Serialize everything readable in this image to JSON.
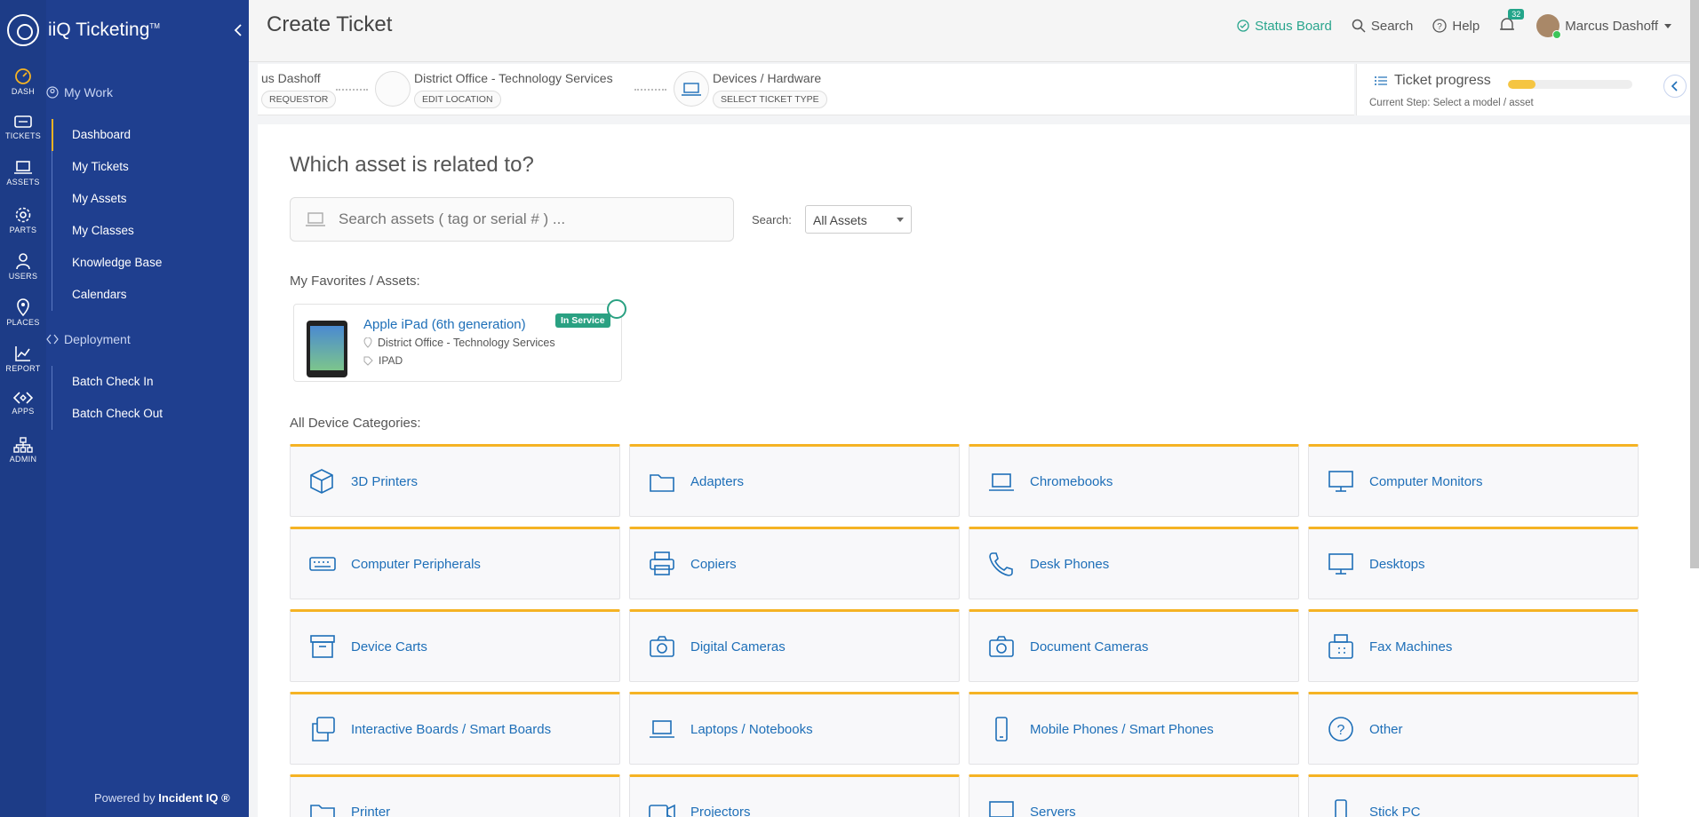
{
  "app": {
    "brand": "iiQ Ticketing",
    "trademark": "TM",
    "powered_prefix": "Powered by",
    "powered_brand": "Incident IQ ®"
  },
  "rail": [
    {
      "label": "DASH",
      "icon": "dashboard-icon"
    },
    {
      "label": "TICKETS",
      "icon": "tickets-icon"
    },
    {
      "label": "ASSETS",
      "icon": "laptop-icon"
    },
    {
      "label": "PARTS",
      "icon": "gear-icon"
    },
    {
      "label": "USERS",
      "icon": "user-icon"
    },
    {
      "label": "PLACES",
      "icon": "map-pin-icon"
    },
    {
      "label": "REPORT",
      "icon": "chart-icon"
    },
    {
      "label": "APPS",
      "icon": "apps-icon"
    },
    {
      "label": "ADMIN",
      "icon": "org-chart-icon"
    }
  ],
  "nav": {
    "section1": "My Work",
    "links1": [
      "Dashboard",
      "My Tickets",
      "My Assets",
      "My Classes",
      "Knowledge Base",
      "Calendars"
    ],
    "section2": "Deployment",
    "links2": [
      "Batch Check In",
      "Batch Check Out"
    ]
  },
  "header": {
    "title": "Create Ticket",
    "status_board": "Status Board",
    "search": "Search",
    "help": "Help",
    "notifications": "32",
    "user": "Marcus Dashoff"
  },
  "steps": [
    {
      "name": "us Dashoff",
      "action": "REQUESTOR"
    },
    {
      "name": "District Office - Technology Services",
      "action": "EDIT LOCATION"
    },
    {
      "name": "Devices / Hardware",
      "action": "SELECT TICKET TYPE"
    }
  ],
  "progress": {
    "title": "Ticket progress",
    "current_step": "Current Step: Select a model / asset",
    "fraction": 0.22
  },
  "main": {
    "heading": "Which asset is related to?",
    "search_placeholder": "Search assets ( tag or serial # ) ...",
    "search_label": "Search:",
    "search_scope": "All Assets",
    "favorites_heading": "My Favorites / Assets:",
    "categories_heading": "All Device Categories:"
  },
  "favorite": {
    "name": "Apple iPad (6th generation)",
    "status": "In Service",
    "location": "District Office - Technology Services",
    "tag": "IPAD"
  },
  "categories": [
    "3D Printers",
    "Adapters",
    "Chromebooks",
    "Computer Monitors",
    "Computer Peripherals",
    "Copiers",
    "Desk Phones",
    "Desktops",
    "Device Carts",
    "Digital Cameras",
    "Document Cameras",
    "Fax Machines",
    "Interactive Boards / Smart Boards",
    "Laptops / Notebooks",
    "Mobile Phones / Smart Phones",
    "Other",
    "Printer",
    "Projectors",
    "Servers",
    "Stick PC"
  ],
  "colors": {
    "sidebar": "#1f3f8f",
    "accent": "#f5b324",
    "link": "#1e6fb8",
    "success": "#2aa182"
  }
}
